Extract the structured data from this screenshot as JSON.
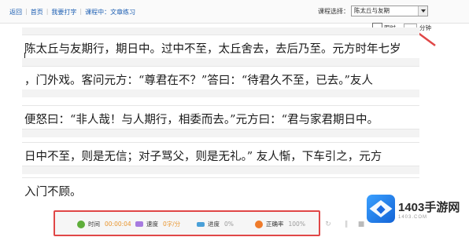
{
  "nav": {
    "items": [
      {
        "label": "返回"
      },
      {
        "label": "首页"
      },
      {
        "label": "我要打字"
      },
      {
        "label": "课程中：文章练习"
      }
    ]
  },
  "course": {
    "label": "课程选择：",
    "selected": "陈太丘与友期"
  },
  "timer": {
    "label": "限时",
    "unit": "分钟"
  },
  "text_lines": [
    "陈太丘与友期行，期日中。过中不至，太丘舍去，去后乃至。元方时年七岁",
    "，门外戏。客问元方：“尊君在不？”答曰：“待君久不至，已去。”友人",
    "便怒曰：“非人哉！与人期行，相委而去。”元方曰：“君与家君期日中。",
    "日中不至，则是无信；对子骂父，则是无礼。” 友人惭，下车引之，元方",
    "入门不顾。"
  ],
  "status": {
    "time_label": "时间",
    "time_value": "00:00:04",
    "speed_label": "速度",
    "speed_value": "0字/分",
    "progress_label": "进度",
    "progress_value": "0%",
    "accuracy_label": "正确率",
    "accuracy_value": "100%"
  },
  "watermark": {
    "name": "1403手游网",
    "url": "1403.COM"
  },
  "colors": {
    "link": "#1d5fb3",
    "annotation": "#e04747",
    "stat_value": "#e8952e"
  }
}
